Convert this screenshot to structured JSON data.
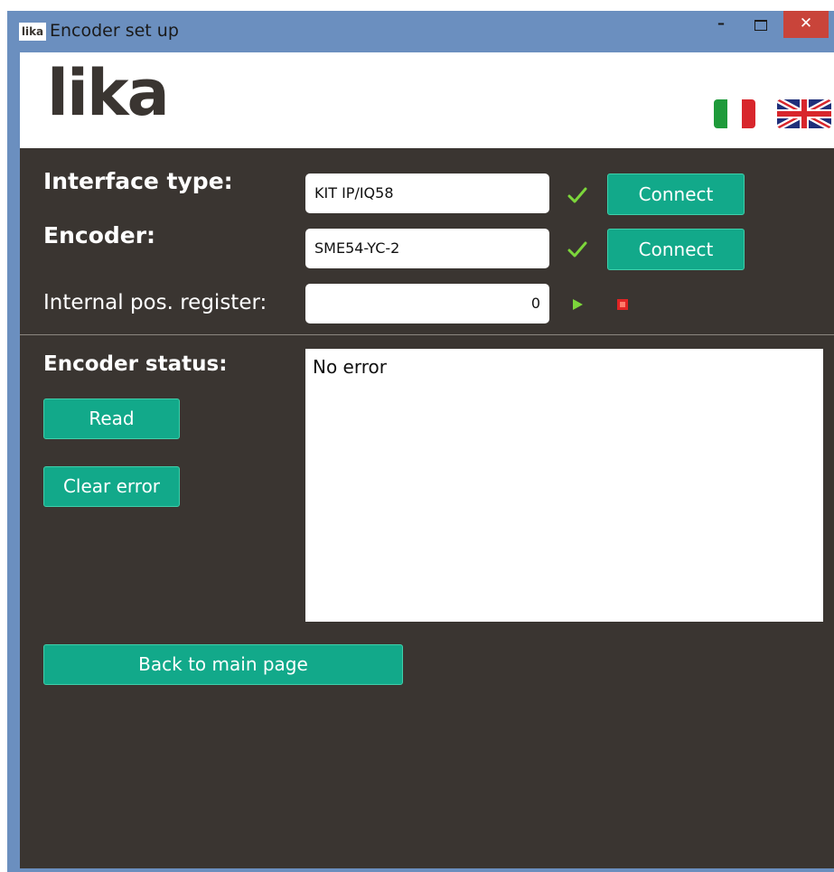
{
  "window": {
    "title": "Encoder set up",
    "app_icon_text": "lika",
    "minimize_glyph": "–",
    "close_glyph": "✕"
  },
  "header": {
    "logo_text": "lika",
    "flags": [
      "italian-flag",
      "uk-flag"
    ]
  },
  "interface_type": {
    "label": "Interface type:",
    "value": "KIT IP/IQ58",
    "connect_label": "Connect",
    "status": "ok"
  },
  "encoder": {
    "label": "Encoder:",
    "value": "SME54-YC-2",
    "connect_label": "Connect",
    "status": "ok"
  },
  "position": {
    "label": "Internal pos. register:",
    "value": "0"
  },
  "status": {
    "label": "Encoder status:",
    "read_label": "Read",
    "clear_label": "Clear error",
    "message": "No error"
  },
  "back_label": "Back to main page",
  "colors": {
    "accent": "#12a98a",
    "background": "#3a3531",
    "titlebar": "#6b8fbf",
    "close": "#c9443a",
    "check": "#7cd63b",
    "stop": "#e02424"
  }
}
